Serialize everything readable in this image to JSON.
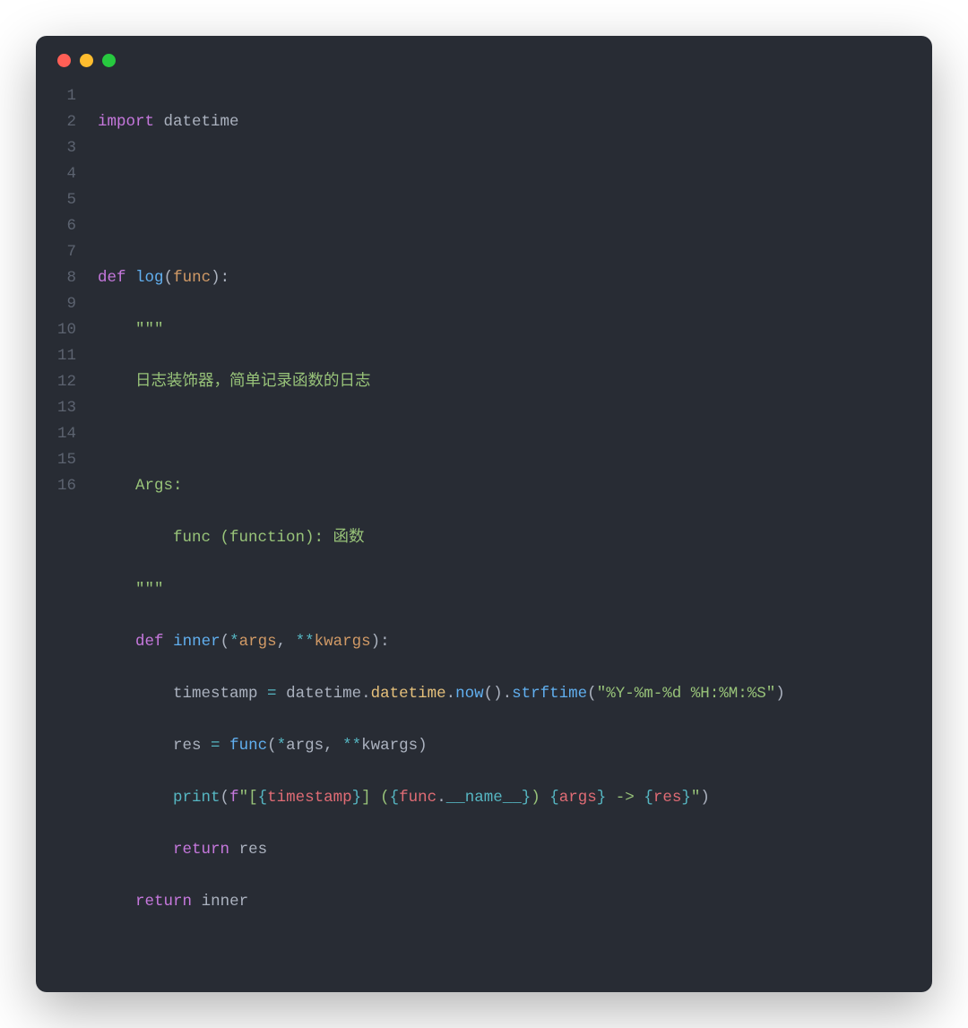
{
  "window": {
    "controls": {
      "close": "red",
      "minimize": "yellow",
      "zoom": "green"
    }
  },
  "editor": {
    "language": "python",
    "total_lines": 16,
    "line_numbers": [
      "1",
      "2",
      "3",
      "4",
      "5",
      "6",
      "7",
      "8",
      "9",
      "10",
      "11",
      "12",
      "13",
      "14",
      "15",
      "16"
    ]
  },
  "code": {
    "l1": {
      "import_kw": "import",
      "module": " datetime"
    },
    "l2": "",
    "l3": "",
    "l4": {
      "def_kw": "def",
      "sp": " ",
      "name": "log",
      "open": "(",
      "param": "func",
      "close": "):"
    },
    "l5": {
      "indent": "    ",
      "q": "\"\"\""
    },
    "l6": {
      "indent": "    ",
      "text": "日志装饰器，简单记录函数的日志"
    },
    "l7": "",
    "l8": {
      "indent": "    ",
      "text": "Args:"
    },
    "l9": {
      "indent": "        ",
      "text": "func (function): 函数"
    },
    "l10": {
      "indent": "    ",
      "q": "\"\"\""
    },
    "l11": {
      "indent": "    ",
      "def_kw": "def",
      "sp": " ",
      "name": "inner",
      "open": "(",
      "star1": "*",
      "args": "args",
      "comma": ", ",
      "star2": "**",
      "kwargs": "kwargs",
      "close": "):"
    },
    "l12": {
      "indent": "        ",
      "lhs": "timestamp",
      "eq": " = ",
      "mod1": "datetime",
      "dot1": ".",
      "mod2": "datetime",
      "dot2": ".",
      "now": "now",
      "call1": "().",
      "strftime": "strftime",
      "open": "(",
      "fmt": "\"%Y-%m-%d %H:%M:%S\"",
      "close": ")"
    },
    "l13": {
      "indent": "        ",
      "lhs": "res",
      "eq": " = ",
      "fn": "func",
      "open": "(",
      "star1": "*",
      "args": "args",
      "comma": ", ",
      "star2": "**",
      "kwargs": "kwargs",
      "close": ")"
    },
    "l14": {
      "indent": "        ",
      "print": "print",
      "open": "(",
      "fpre": "f",
      "q1": "\"[",
      "ob1": "{",
      "i1": "timestamp",
      "cb1": "}",
      "q2": "] (",
      "ob2": "{",
      "func": "func",
      "dot": ".",
      "dunder": "__name__",
      "cb2": "}",
      "q3": ") ",
      "ob3": "{",
      "i3": "args",
      "cb3": "}",
      "q4": " -> ",
      "ob4": "{",
      "i4": "res",
      "cb4": "}",
      "q5": "\"",
      "close": ")"
    },
    "l15": {
      "indent": "        ",
      "ret_kw": "return",
      "sp": " ",
      "val": "res"
    },
    "l16": {
      "indent": "    ",
      "ret_kw": "return",
      "sp": " ",
      "val": "inner"
    }
  }
}
